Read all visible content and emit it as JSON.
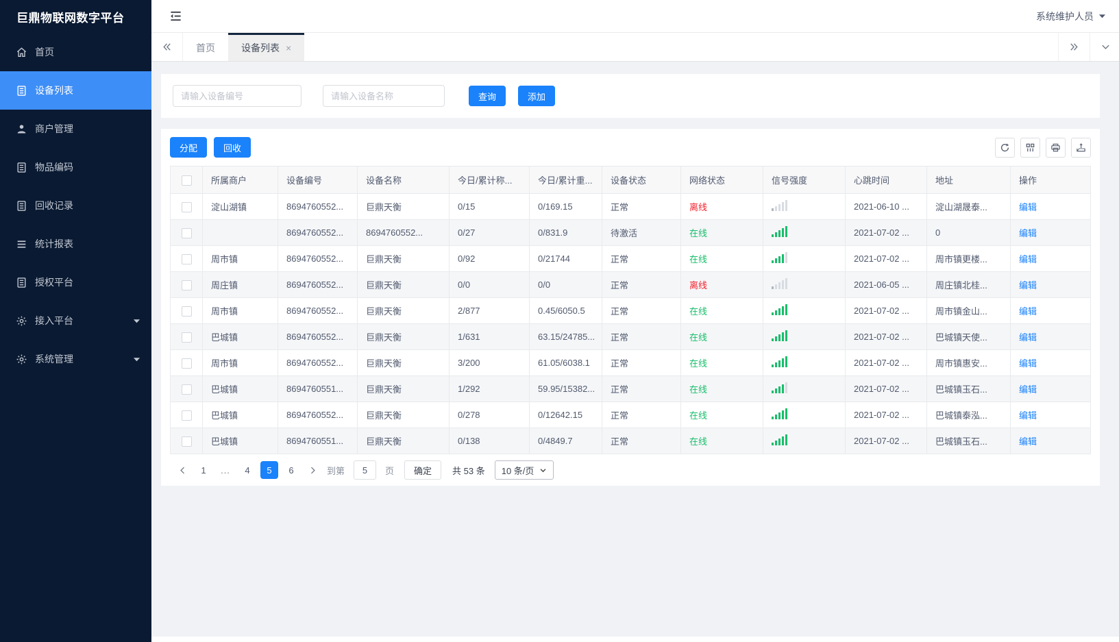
{
  "colors": {
    "primary": "#1a82fb",
    "sidebar_bg": "#0a1a32",
    "sidebar_active": "#3e8ef7",
    "online_green": "#19be6b",
    "offline_red": "#f5222d"
  },
  "app": {
    "logo": "巨鼎物联网数字平台",
    "user_name": "系统维护人员"
  },
  "sidebar": {
    "items": [
      {
        "id": "home",
        "label": "首页",
        "icon": "home",
        "active": false,
        "caret": false
      },
      {
        "id": "device-list",
        "label": "设备列表",
        "icon": "doc",
        "active": true,
        "caret": false
      },
      {
        "id": "merchant-mgmt",
        "label": "商户管理",
        "icon": "user",
        "active": false,
        "caret": false
      },
      {
        "id": "item-code",
        "label": "物品编码",
        "icon": "doc",
        "active": false,
        "caret": false
      },
      {
        "id": "recycle-records",
        "label": "回收记录",
        "icon": "doc",
        "active": false,
        "caret": false
      },
      {
        "id": "stats-report",
        "label": "统计报表",
        "icon": "lines",
        "active": false,
        "caret": false
      },
      {
        "id": "auth-platform",
        "label": "授权平台",
        "icon": "doc",
        "active": false,
        "caret": false
      },
      {
        "id": "access-platform",
        "label": "接入平台",
        "icon": "gear",
        "active": false,
        "caret": true
      },
      {
        "id": "system-mgmt",
        "label": "系统管理",
        "icon": "gear",
        "active": false,
        "caret": true
      }
    ]
  },
  "tabs": {
    "items": [
      {
        "id": "home",
        "label": "首页",
        "active": false,
        "closable": false
      },
      {
        "id": "device-list",
        "label": "设备列表",
        "active": true,
        "closable": true
      }
    ]
  },
  "search": {
    "device_no_placeholder": "请输入设备编号",
    "device_name_placeholder": "请输入设备名称",
    "query_label": "查询",
    "add_label": "添加"
  },
  "toolbar": {
    "assign_label": "分配",
    "recycle_label": "回收"
  },
  "table": {
    "headers": [
      "所属商户",
      "设备编号",
      "设备名称",
      "今日/累计称...",
      "今日/累计重...",
      "设备状态",
      "网络状态",
      "信号强度",
      "心跳时间",
      "地址",
      "操作"
    ],
    "rows": [
      {
        "merchant": "淀山湖镇",
        "device_no": "8694760552...",
        "device_name": "巨鼎天衡",
        "today_count": "0/15",
        "today_weight": "0/169.15",
        "device_status": "正常",
        "network_status": "离线",
        "network_state": "offline",
        "signal": 0,
        "heartbeat": "2021-06-10 ...",
        "address": "淀山湖晟泰...",
        "action": "编辑"
      },
      {
        "merchant": "",
        "device_no": "8694760552...",
        "device_name": "8694760552...",
        "today_count": "0/27",
        "today_weight": "0/831.9",
        "device_status": "待激活",
        "network_status": "在线",
        "network_state": "online",
        "signal": 5,
        "heartbeat": "2021-07-02 ...",
        "address": "0",
        "action": "编辑"
      },
      {
        "merchant": "周市镇",
        "device_no": "8694760552...",
        "device_name": "巨鼎天衡",
        "today_count": "0/92",
        "today_weight": "0/21744",
        "device_status": "正常",
        "network_status": "在线",
        "network_state": "online",
        "signal": 4,
        "heartbeat": "2021-07-02 ...",
        "address": "周市镇更楼...",
        "action": "编辑"
      },
      {
        "merchant": "周庄镇",
        "device_no": "8694760552...",
        "device_name": "巨鼎天衡",
        "today_count": "0/0",
        "today_weight": "0/0",
        "device_status": "正常",
        "network_status": "离线",
        "network_state": "offline",
        "signal": 0,
        "heartbeat": "2021-06-05 ...",
        "address": "周庄镇北桂...",
        "action": "编辑"
      },
      {
        "merchant": "周市镇",
        "device_no": "8694760552...",
        "device_name": "巨鼎天衡",
        "today_count": "2/877",
        "today_weight": "0.45/6050.5",
        "device_status": "正常",
        "network_status": "在线",
        "network_state": "online",
        "signal": 5,
        "heartbeat": "2021-07-02 ...",
        "address": "周市镇金山...",
        "action": "编辑"
      },
      {
        "merchant": "巴城镇",
        "device_no": "8694760552...",
        "device_name": "巨鼎天衡",
        "today_count": "1/631",
        "today_weight": "63.15/24785...",
        "device_status": "正常",
        "network_status": "在线",
        "network_state": "online",
        "signal": 5,
        "heartbeat": "2021-07-02 ...",
        "address": "巴城镇天使...",
        "action": "编辑"
      },
      {
        "merchant": "周市镇",
        "device_no": "8694760552...",
        "device_name": "巨鼎天衡",
        "today_count": "3/200",
        "today_weight": "61.05/6038.1",
        "device_status": "正常",
        "network_status": "在线",
        "network_state": "online",
        "signal": 5,
        "heartbeat": "2021-07-02 ...",
        "address": "周市镇惠安...",
        "action": "编辑"
      },
      {
        "merchant": "巴城镇",
        "device_no": "8694760551...",
        "device_name": "巨鼎天衡",
        "today_count": "1/292",
        "today_weight": "59.95/15382...",
        "device_status": "正常",
        "network_status": "在线",
        "network_state": "online",
        "signal": 4,
        "heartbeat": "2021-07-02 ...",
        "address": "巴城镇玉石...",
        "action": "编辑"
      },
      {
        "merchant": "巴城镇",
        "device_no": "8694760552...",
        "device_name": "巨鼎天衡",
        "today_count": "0/278",
        "today_weight": "0/12642.15",
        "device_status": "正常",
        "network_status": "在线",
        "network_state": "online",
        "signal": 5,
        "heartbeat": "2021-07-02 ...",
        "address": "巴城镇泰泓...",
        "action": "编辑"
      },
      {
        "merchant": "巴城镇",
        "device_no": "8694760551...",
        "device_name": "巨鼎天衡",
        "today_count": "0/138",
        "today_weight": "0/4849.7",
        "device_status": "正常",
        "network_status": "在线",
        "network_state": "online",
        "signal": 5,
        "heartbeat": "2021-07-02 ...",
        "address": "巴城镇玉石...",
        "action": "编辑"
      }
    ]
  },
  "pagination": {
    "pages": [
      {
        "label": "1",
        "active": false,
        "ellipsis": false
      },
      {
        "label": "...",
        "active": false,
        "ellipsis": true
      },
      {
        "label": "4",
        "active": false,
        "ellipsis": false
      },
      {
        "label": "5",
        "active": true,
        "ellipsis": false
      },
      {
        "label": "6",
        "active": false,
        "ellipsis": false
      }
    ],
    "goto_label": "到第",
    "goto_value": "5",
    "page_unit_label": "页",
    "confirm_label": "确定",
    "total_label": "共 53 条",
    "page_size_label": "10 条/页"
  }
}
